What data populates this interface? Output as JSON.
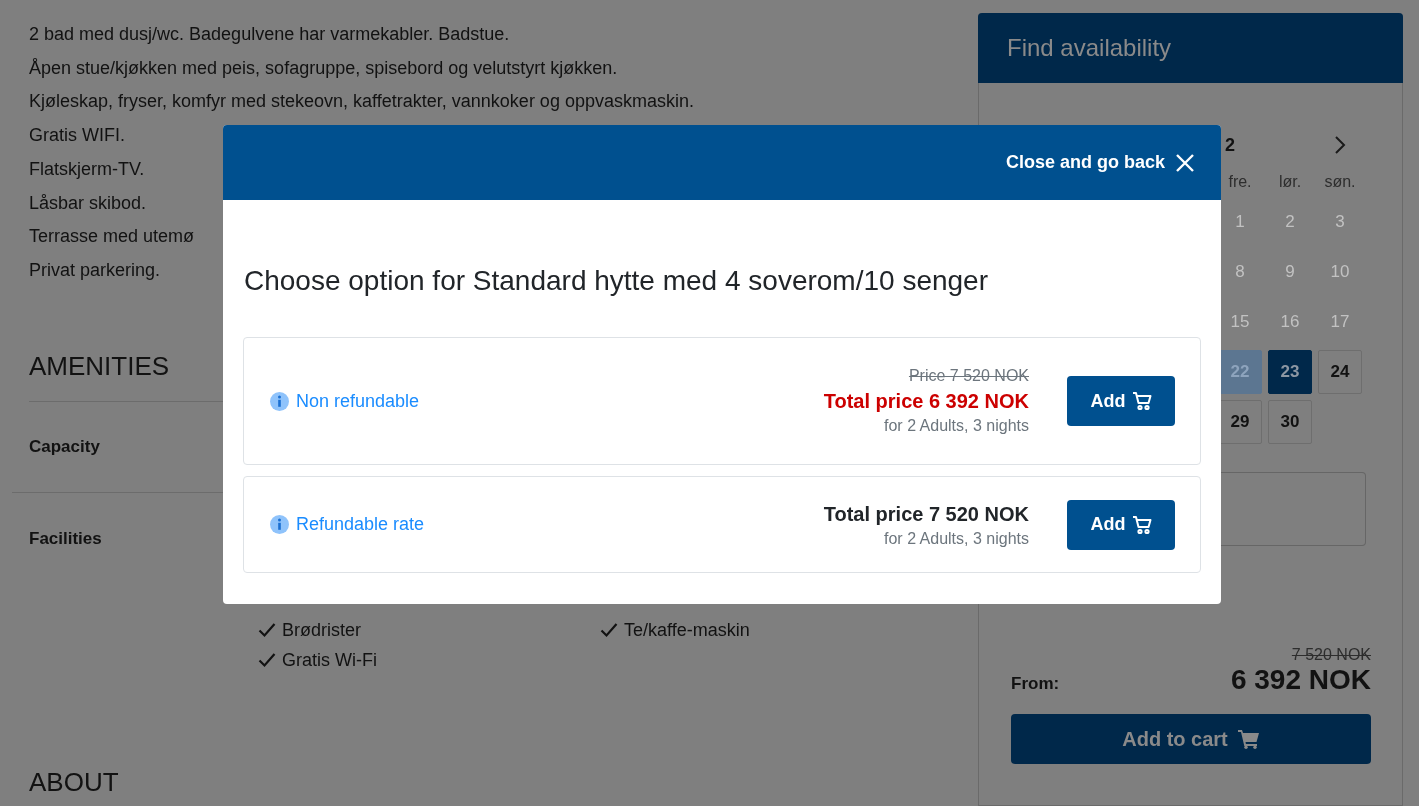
{
  "page": {
    "description_lines": [
      "2 bad med dusj/wc. Badegulvene har varmekabler. Badstue.",
      "Åpen stue/kjøkken med peis, sofagruppe, spisebord og velutstyrt kjøkken.",
      "Kjøleskap, fryser, komfyr med stekeovn, kaffetrakter, vannkoker og oppvaskmaskin.",
      "Gratis WIFI.",
      "Flatskjerm-TV.",
      "Låsbar skibod.",
      "Terrasse med utemø",
      "Privat parkering."
    ],
    "amenities_heading": "AMENITIES",
    "amenity_rows": [
      {
        "label": "Capacity",
        "columns": []
      },
      {
        "label": "Facilities",
        "columns": [
          {
            "items": [
              "Brødrister",
              "Gratis Wi-Fi"
            ]
          },
          {
            "items": [
              "Te/kaffe-maskin"
            ]
          }
        ]
      }
    ],
    "about_heading": "ABOUT"
  },
  "availability": {
    "title": "Find availability",
    "month_label": "2",
    "weekdays": [
      "fre.",
      "lør.",
      "søn."
    ],
    "weeks": [
      [
        {
          "day": "1",
          "disabled": true,
          "in_range": false,
          "selected": false
        },
        {
          "day": "2",
          "disabled": true,
          "in_range": false,
          "selected": false
        },
        {
          "day": "3",
          "disabled": true,
          "in_range": false,
          "selected": false
        }
      ],
      [
        {
          "day": "8",
          "disabled": true,
          "in_range": false,
          "selected": false
        },
        {
          "day": "9",
          "disabled": true,
          "in_range": false,
          "selected": false
        },
        {
          "day": "10",
          "disabled": true,
          "in_range": false,
          "selected": false
        }
      ],
      [
        {
          "day": "15",
          "disabled": true,
          "in_range": false,
          "selected": false
        },
        {
          "day": "16",
          "disabled": true,
          "in_range": false,
          "selected": false
        },
        {
          "day": "17",
          "disabled": true,
          "in_range": false,
          "selected": false
        }
      ],
      [
        {
          "day": "22",
          "disabled": false,
          "in_range": true,
          "selected": false
        },
        {
          "day": "23",
          "disabled": false,
          "in_range": false,
          "selected": true
        },
        {
          "day": "24",
          "disabled": false,
          "in_range": false,
          "selected": false
        }
      ],
      [
        {
          "day": "29",
          "disabled": false,
          "in_range": false,
          "selected": false
        },
        {
          "day": "30",
          "disabled": false,
          "in_range": false,
          "selected": false
        }
      ]
    ],
    "original_price": "7 520 NOK",
    "from_label": "From:",
    "price": "6 392 NOK",
    "add_to_cart": "Add to cart"
  },
  "modal": {
    "close_label": "Close and go back",
    "title": "Choose option for Standard hytte med 4 soverom/10 senger",
    "options": [
      {
        "name": "Non refundable",
        "original_price": "Price 7 520 NOK",
        "total_price": "Total price 6 392 NOK",
        "discounted": true,
        "note": "for 2 Adults, 3 nights",
        "button": "Add"
      },
      {
        "name": "Refundable rate",
        "total_price": "Total price 7 520 NOK",
        "discounted": false,
        "note": "for 2 Adults, 3 nights",
        "button": "Add"
      }
    ]
  }
}
